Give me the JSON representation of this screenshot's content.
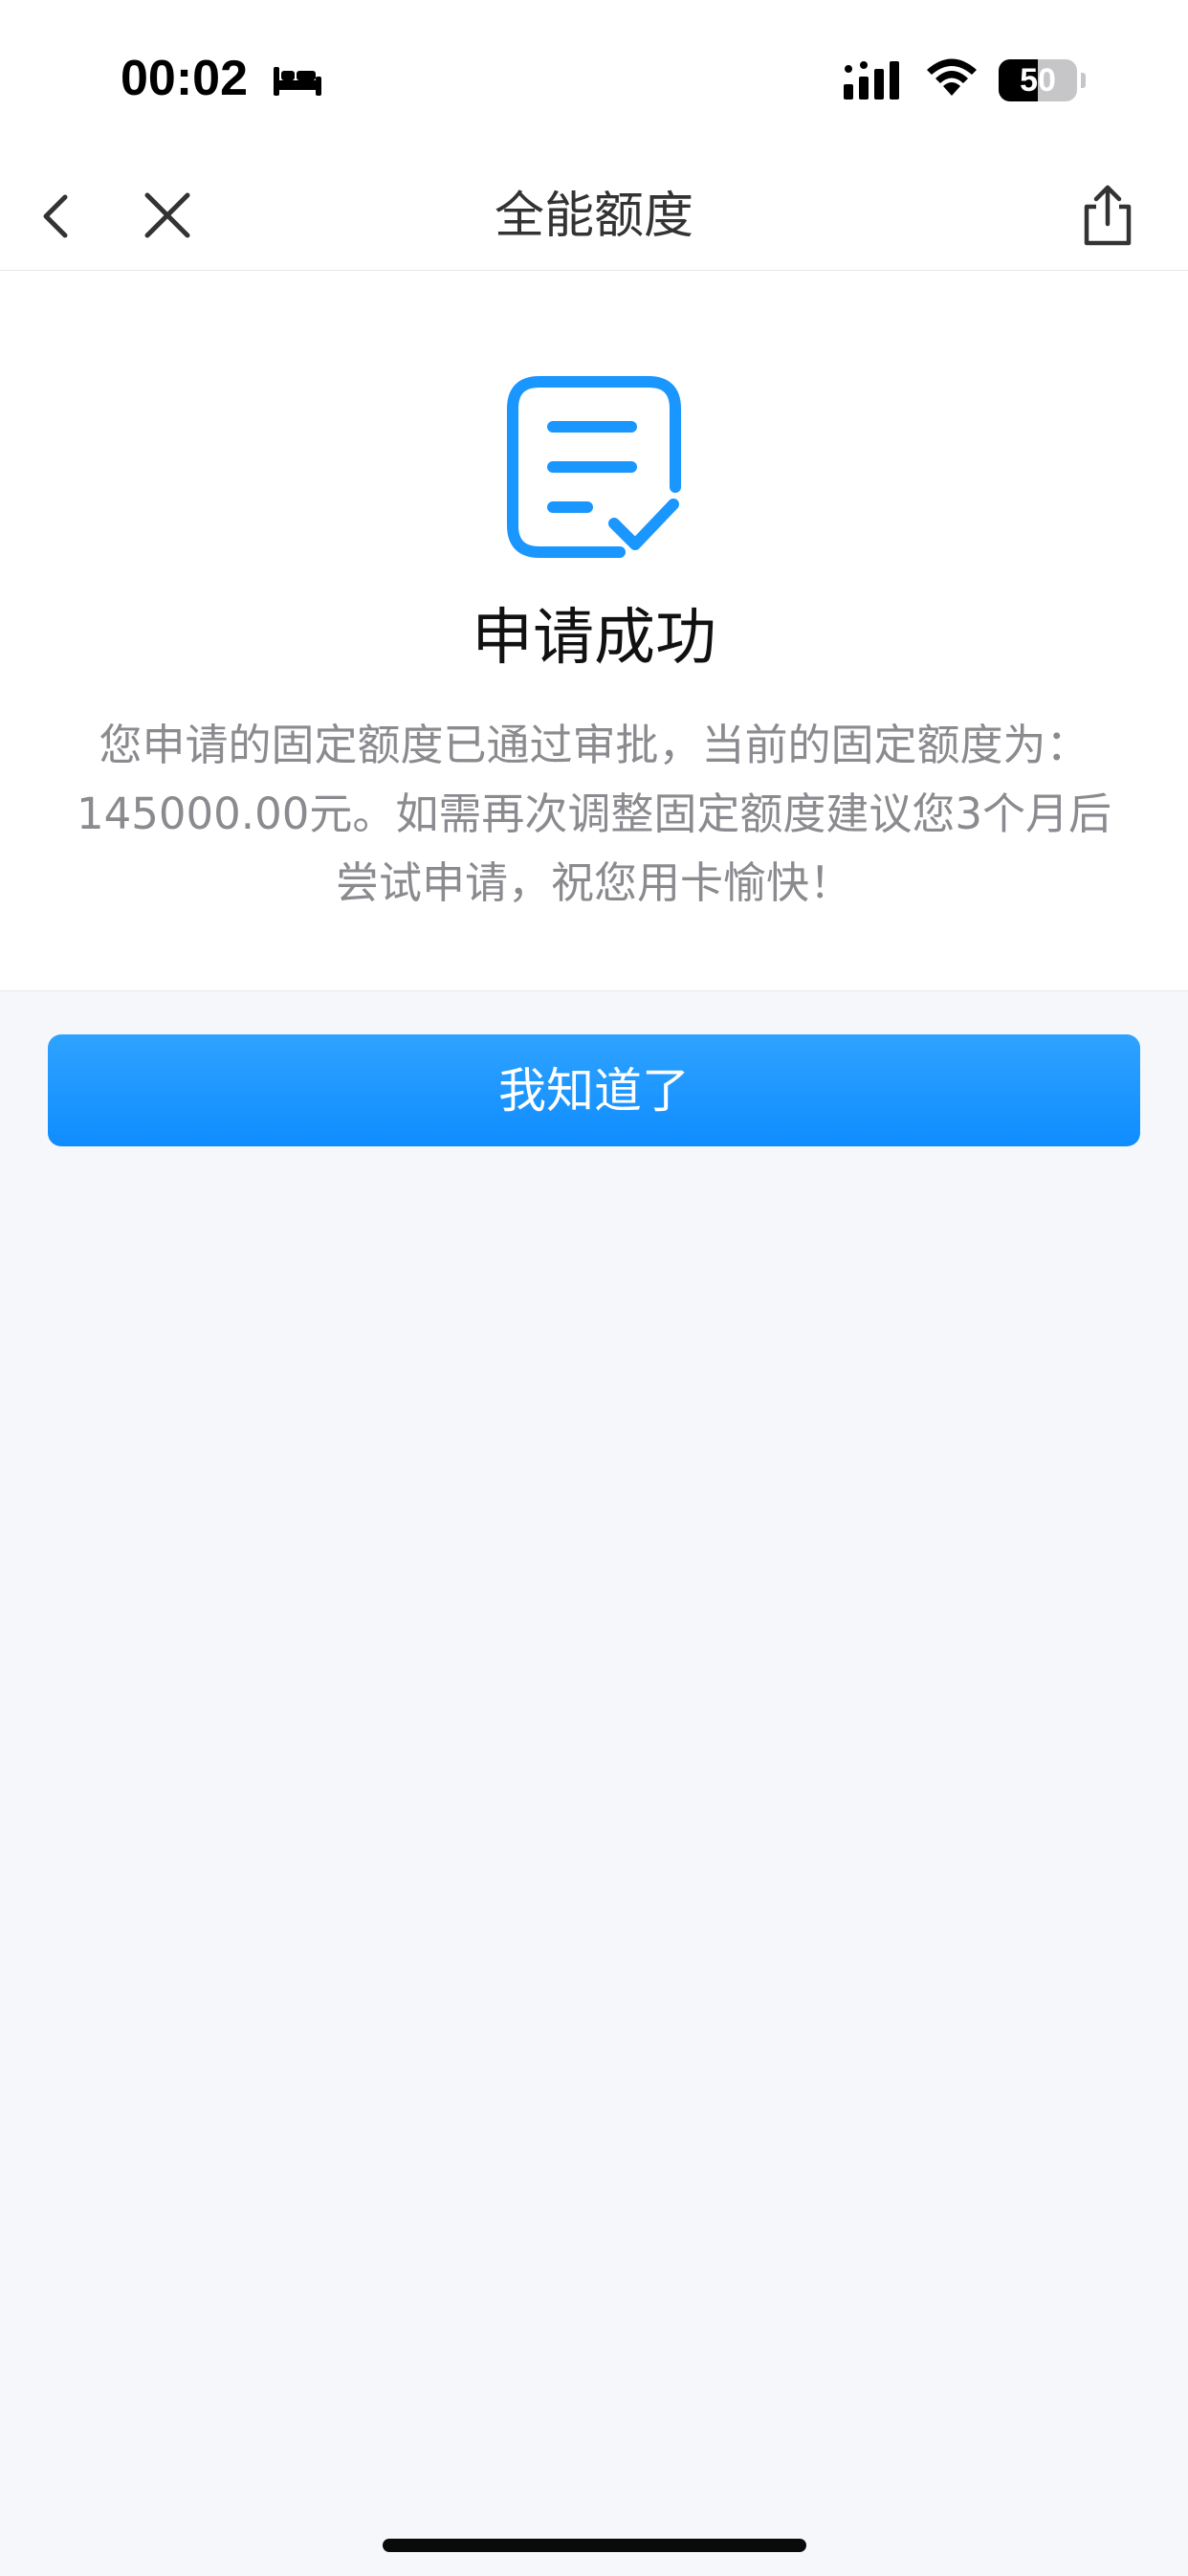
{
  "status_bar": {
    "time": "00:02",
    "battery_percent": "50",
    "battery_level": 0.5,
    "icons": [
      "bed-icon",
      "signal-icon",
      "wifi-icon",
      "battery-icon"
    ]
  },
  "nav": {
    "title": "全能额度",
    "icons": [
      "chevron-left-icon",
      "close-icon",
      "share-icon"
    ]
  },
  "result": {
    "icon": "document-check-icon",
    "title": "申请成功",
    "description": "您申请的固定额度已通过审批，当前的固定额度为：145000.00元。如需再次调整固定额度建议您3个月后尝试申请，祝您用卡愉快！"
  },
  "actions": {
    "confirm_label": "我知道了"
  },
  "colors": {
    "accent": "#1a96ff",
    "background": "#f6f7fb",
    "title_text": "#333333",
    "description_text": "#8a8a8f"
  }
}
